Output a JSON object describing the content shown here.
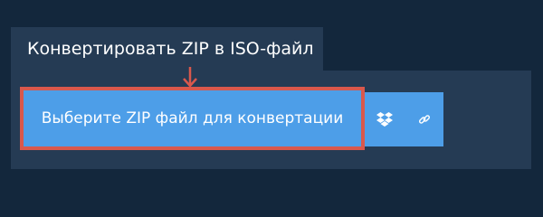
{
  "tab": {
    "title": "Конвертировать ZIP в ISO-файл"
  },
  "upload": {
    "choose_file_label": "Выберите ZIP файл для конвертации"
  },
  "icons": {
    "arrow": "arrow-down-icon",
    "dropbox": "dropbox-icon",
    "link": "link-icon"
  },
  "colors": {
    "page_background": "#13273c",
    "panel_background": "#253b54",
    "button_blue": "#4d9ee8",
    "highlight_red": "#d9584c",
    "text_white": "#ffffff"
  }
}
